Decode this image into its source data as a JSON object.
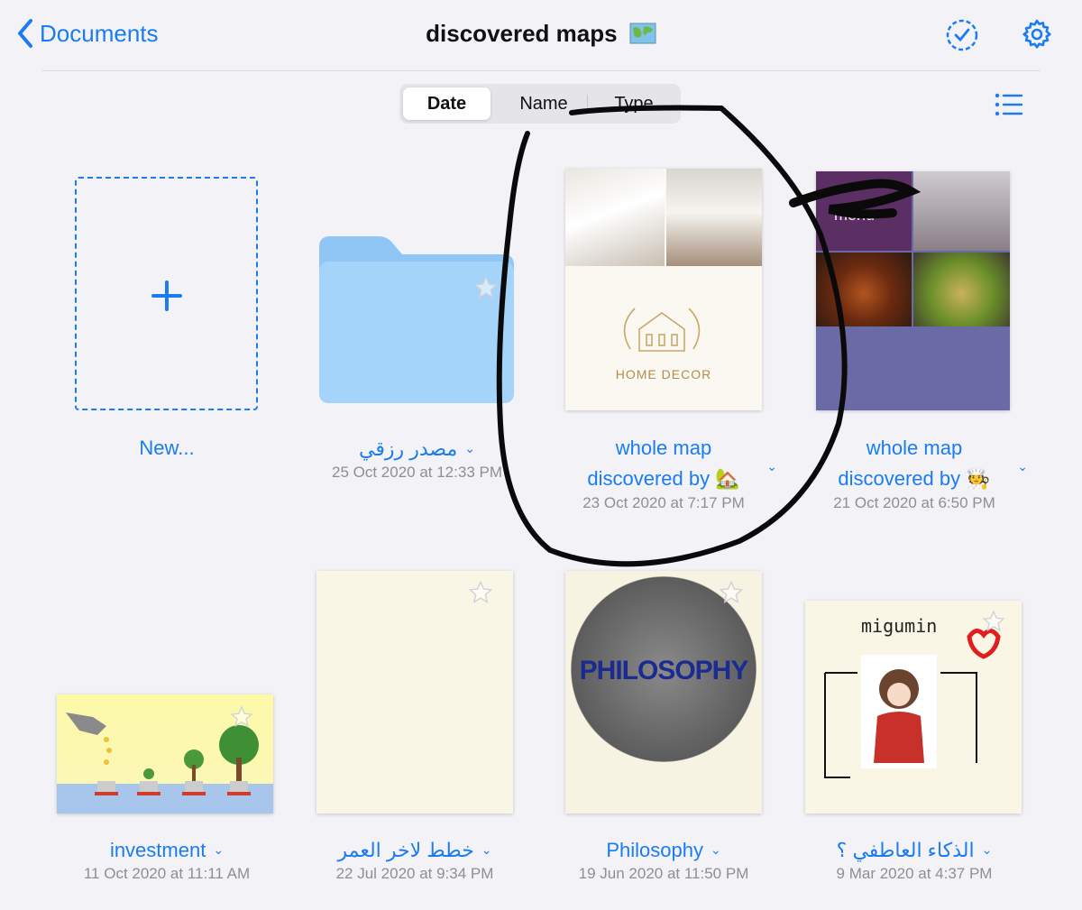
{
  "nav": {
    "back_label": "Documents",
    "title": "discovered maps"
  },
  "sort": {
    "options": [
      "Date",
      "Name",
      "Type"
    ],
    "selected": "Date"
  },
  "new_item": {
    "label": "New..."
  },
  "items": [
    {
      "name": "مصدر رزقي",
      "date": "25 Oct 2020 at 12:33 PM",
      "kind": "folder"
    },
    {
      "name_line1": "whole map",
      "name_line2": "discovered by",
      "date": "23 Oct 2020 at 7:17 PM",
      "thumb_text": "HOME DECOR"
    },
    {
      "name_line1": "whole map",
      "name_line2": "discovered by",
      "date": "21 Oct 2020 at 6:50 PM",
      "thumb_text": "menu"
    },
    {
      "name": "investment",
      "date": "11 Oct 2020 at 11:11 AM"
    },
    {
      "name": "خطط لاخر العمر",
      "date": "22 Jul 2020 at 9:34 PM"
    },
    {
      "name": "Philosophy",
      "date": "19 Jun 2020 at 11:50 PM",
      "thumb_text": "PHILOSOPHY"
    },
    {
      "name": "الذكاء العاطفي ؟",
      "date": "9 Mar 2020 at 4:37 PM",
      "thumb_text": "migumin"
    }
  ],
  "colors": {
    "accent": "#1a7cf0",
    "background": "#f2f2f7",
    "folder": "#a5d4fb"
  }
}
